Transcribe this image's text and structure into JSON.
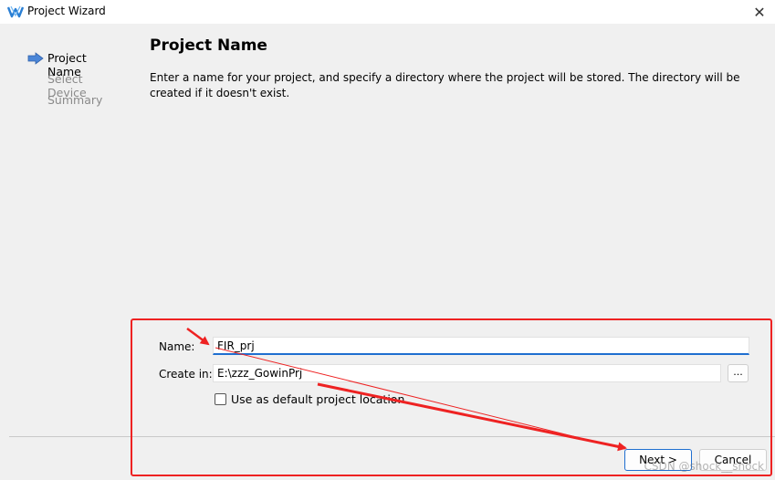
{
  "window": {
    "title": "Project Wizard",
    "icon": "gowin-logo-icon",
    "close_glyph": "✕"
  },
  "steps": [
    {
      "label": "Project Name",
      "state": "active"
    },
    {
      "label": "Select Device",
      "state": "inactive"
    },
    {
      "label": "Summary",
      "state": "inactive"
    }
  ],
  "page": {
    "heading": "Project Name",
    "description": "Enter a name for your project, and specify a directory where the project will be stored. The directory will be created if it doesn't exist."
  },
  "form": {
    "name_label": "Name:",
    "name_value": "FIR_prj",
    "location_label": "Create in:",
    "location_value": "E:\\zzz_GowinPrj",
    "browse_label": "...",
    "default_location_label": "Use as default project location",
    "default_location_checked": false
  },
  "buttons": {
    "next_label": "Next >",
    "cancel_label": "Cancel"
  },
  "annotation": {
    "color": "#ee2222",
    "watermark": "CSDN @shock__shock"
  },
  "colors": {
    "focus": "#1f6fd0",
    "step_arrow": "#4a86d8",
    "background": "#f0f0f0"
  }
}
